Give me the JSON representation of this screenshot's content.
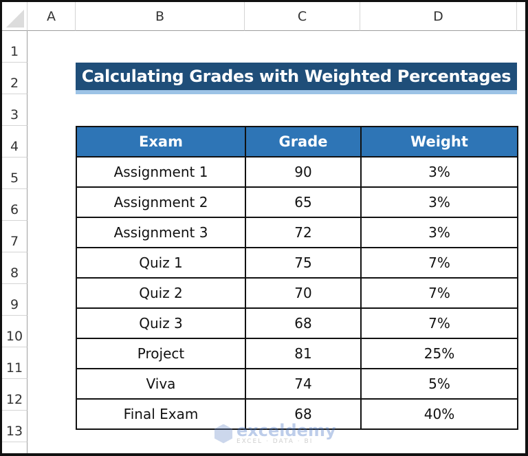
{
  "spreadsheet": {
    "columns": [
      "A",
      "B",
      "C",
      "D"
    ],
    "rows": [
      "1",
      "2",
      "3",
      "4",
      "5",
      "6",
      "7",
      "8",
      "9",
      "10",
      "11",
      "12",
      "13"
    ]
  },
  "title": "Calculating Grades with Weighted Percentages",
  "table": {
    "headers": [
      "Exam",
      "Grade",
      "Weight"
    ],
    "rows": [
      [
        "Assignment 1",
        "90",
        "3%"
      ],
      [
        "Assignment 2",
        "65",
        "3%"
      ],
      [
        "Assignment 3",
        "72",
        "3%"
      ],
      [
        "Quiz 1",
        "75",
        "7%"
      ],
      [
        "Quiz 2",
        "70",
        "7%"
      ],
      [
        "Quiz 3",
        "68",
        "7%"
      ],
      [
        "Project",
        "81",
        "25%"
      ],
      [
        "Viva",
        "74",
        "5%"
      ],
      [
        "Final Exam",
        "68",
        "40%"
      ]
    ]
  },
  "watermark": {
    "name": "exceldemy",
    "tagline": "EXCEL · DATA · BI"
  },
  "colors": {
    "title_bg": "#1f4e79",
    "title_underline": "#9dc3e6",
    "header_bg": "#2e75b6"
  }
}
